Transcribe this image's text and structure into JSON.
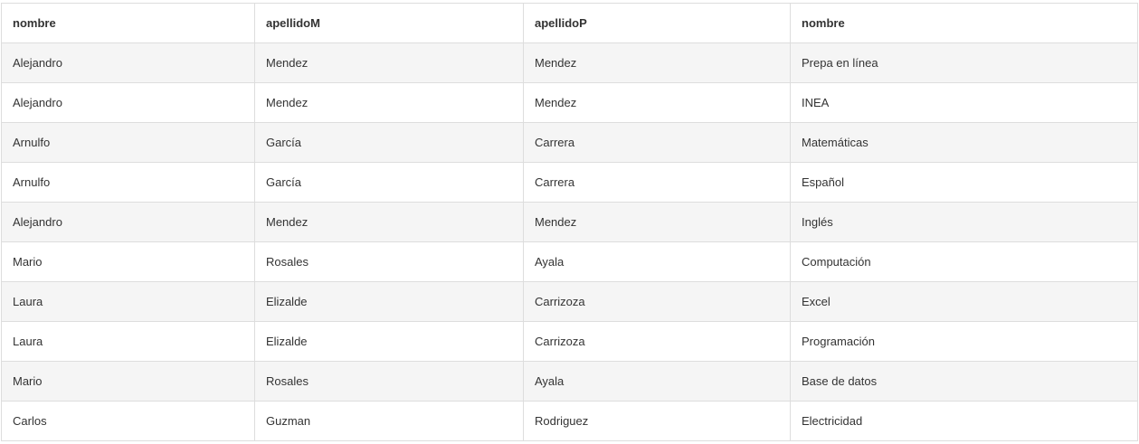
{
  "table": {
    "headers": [
      "nombre",
      "apellidoM",
      "apellidoP",
      "nombre"
    ],
    "rows": [
      [
        "Alejandro",
        "Mendez",
        "Mendez",
        "Prepa en línea"
      ],
      [
        "Alejandro",
        "Mendez",
        "Mendez",
        "INEA"
      ],
      [
        "Arnulfo",
        "García",
        "Carrera",
        "Matemáticas"
      ],
      [
        "Arnulfo",
        "García",
        "Carrera",
        "Español"
      ],
      [
        "Alejandro",
        "Mendez",
        "Mendez",
        "Inglés"
      ],
      [
        "Mario",
        "Rosales",
        "Ayala",
        "Computación"
      ],
      [
        "Laura",
        "Elizalde",
        "Carrizoza",
        "Excel"
      ],
      [
        "Laura",
        "Elizalde",
        "Carrizoza",
        "Programación"
      ],
      [
        "Mario",
        "Rosales",
        "Ayala",
        "Base de datos"
      ],
      [
        "Carlos",
        "Guzman",
        "Rodriguez",
        "Electricidad"
      ]
    ]
  },
  "colors": {
    "border": "#dddddd",
    "stripe": "#f5f5f5",
    "text": "#333333",
    "background": "#ffffff"
  }
}
